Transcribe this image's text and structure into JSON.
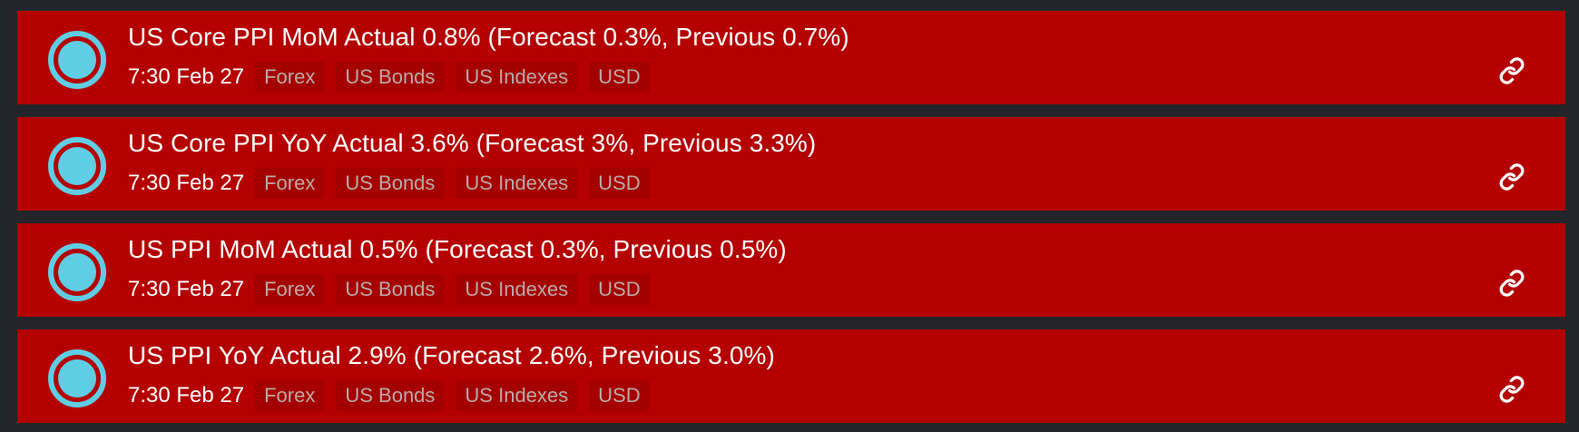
{
  "colors": {
    "background": "#23252b",
    "item_background": "#b40000",
    "tag_background": "#a50000",
    "tag_text": "#b9a9a9",
    "status_icon": "#5fcde4",
    "text": "#ffffff"
  },
  "icons": {
    "status": "ring-dot-icon",
    "link": "link-icon"
  },
  "items": [
    {
      "headline": "US Core PPI MoM Actual 0.8% (Forecast 0.3%, Previous 0.7%)",
      "time": "7:30 Feb 27",
      "tags": [
        "Forex",
        "US Bonds",
        "US Indexes",
        "USD"
      ]
    },
    {
      "headline": "US Core PPI YoY Actual 3.6% (Forecast 3%, Previous 3.3%)",
      "time": "7:30 Feb 27",
      "tags": [
        "Forex",
        "US Bonds",
        "US Indexes",
        "USD"
      ]
    },
    {
      "headline": "US PPI MoM Actual 0.5% (Forecast 0.3%, Previous 0.5%)",
      "time": "7:30 Feb 27",
      "tags": [
        "Forex",
        "US Bonds",
        "US Indexes",
        "USD"
      ]
    },
    {
      "headline": "US PPI YoY Actual 2.9% (Forecast 2.6%, Previous 3.0%)",
      "time": "7:30 Feb 27",
      "tags": [
        "Forex",
        "US Bonds",
        "US Indexes",
        "USD"
      ]
    }
  ]
}
